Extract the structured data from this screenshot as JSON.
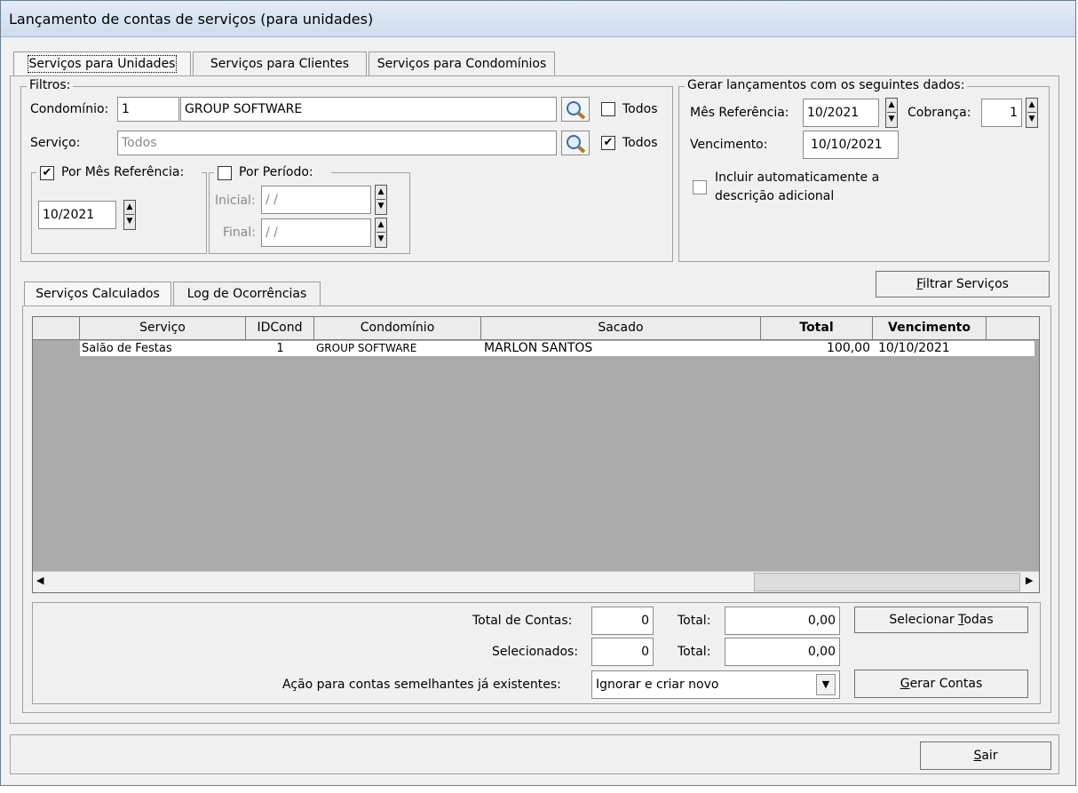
{
  "window": {
    "title": "Lançamento de contas de serviços (para unidades)"
  },
  "tabs": [
    "Serviços para Unidades",
    "Serviços para Clientes",
    "Serviços para Condomínios"
  ],
  "filters": {
    "title": "Filtros:",
    "condominio_label": "Condomínio:",
    "condominio_code": "1",
    "condominio_name": "GROUP SOFTWARE",
    "todos_label": "Todos",
    "servico_label": "Serviço:",
    "servico_value": "Todos",
    "servico_todos_label": "Todos",
    "por_mes_label": "Por Mês Referência:",
    "mes_value": "10/2021",
    "por_periodo_label": "Por Período:",
    "inicial_label": "Inicial:",
    "inicial_value": " / /",
    "final_label": "Final:",
    "final_value": " / /"
  },
  "generate": {
    "title": "Gerar lançamentos com os seguintes dados:",
    "mes_label": "Mês Referência:",
    "mes_value": "10/2021",
    "cobranca_label": "Cobrança:",
    "cobranca_value": "1",
    "vencimento_label": "Vencimento:",
    "vencimento_value": "10/10/2021",
    "incluir_line1": "Incluir automaticamente a",
    "incluir_line2": "descrição adicional"
  },
  "filtrar_button": {
    "underline": "F",
    "rest": "iltrar Serviços"
  },
  "subtabs": [
    "Serviços Calculados",
    "Log de Ocorrências"
  ],
  "grid": {
    "columns": [
      "Serviço",
      "IDCond",
      "Condomínio",
      "Sacado",
      "Total",
      "Vencimento"
    ],
    "rows": [
      {
        "servico": "Salão de Festas",
        "idcond": "1",
        "condominio": "GROUP SOFTWARE",
        "sacado": "MARLON SANTOS",
        "total": "100,00",
        "vencimento": "10/10/2021"
      }
    ]
  },
  "summary": {
    "total_contas_label": "Total de Contas:",
    "total_contas_value": "0",
    "total_label": "Total:",
    "total_value": "0,00",
    "selecionados_label": "Selecionados:",
    "selecionados_value": "0",
    "total2_label": "Total:",
    "total2_value": "0,00",
    "acao_label": "Ação para contas semelhantes já existentes:",
    "acao_value": "Ignorar e criar novo"
  },
  "buttons": {
    "selecionar_pre": "Selecionar ",
    "selecionar_u": "T",
    "selecionar_post": "odas",
    "gerar_u": "G",
    "gerar_post": "erar Contas",
    "sair_u": "S",
    "sair_post": "air"
  }
}
